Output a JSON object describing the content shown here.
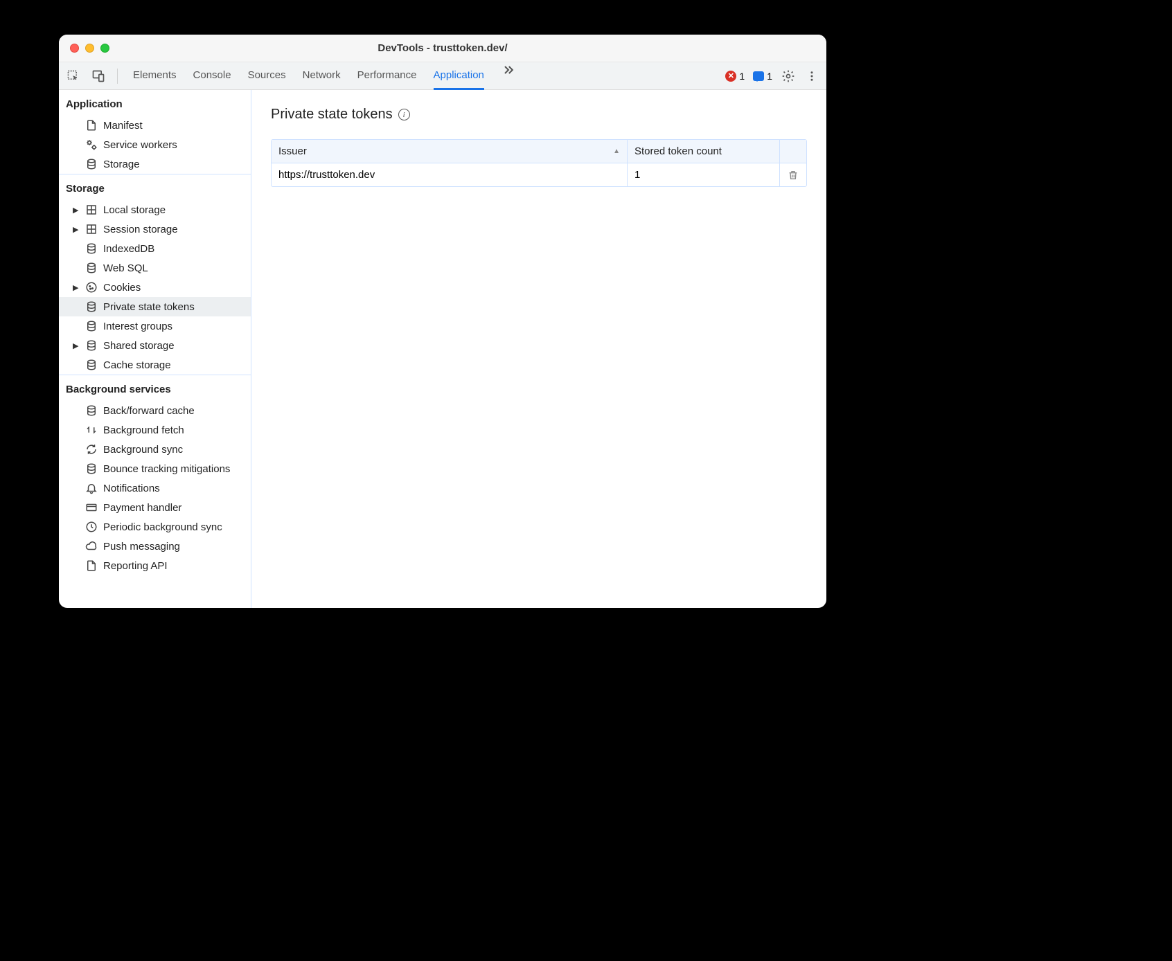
{
  "window": {
    "title": "DevTools - trusttoken.dev/"
  },
  "tabs": {
    "items": [
      "Elements",
      "Console",
      "Sources",
      "Network",
      "Performance",
      "Application"
    ],
    "active": "Application"
  },
  "badges": {
    "errors": "1",
    "messages": "1"
  },
  "sidebar": {
    "sections": [
      {
        "title": "Application",
        "items": [
          {
            "label": "Manifest",
            "icon": "file",
            "arrow": false
          },
          {
            "label": "Service workers",
            "icon": "gears",
            "arrow": false
          },
          {
            "label": "Storage",
            "icon": "db",
            "arrow": false
          }
        ]
      },
      {
        "title": "Storage",
        "items": [
          {
            "label": "Local storage",
            "icon": "grid",
            "arrow": true
          },
          {
            "label": "Session storage",
            "icon": "grid",
            "arrow": true
          },
          {
            "label": "IndexedDB",
            "icon": "db",
            "arrow": false
          },
          {
            "label": "Web SQL",
            "icon": "db",
            "arrow": false
          },
          {
            "label": "Cookies",
            "icon": "cookie",
            "arrow": true
          },
          {
            "label": "Private state tokens",
            "icon": "db",
            "arrow": false,
            "selected": true
          },
          {
            "label": "Interest groups",
            "icon": "db",
            "arrow": false
          },
          {
            "label": "Shared storage",
            "icon": "db",
            "arrow": true
          },
          {
            "label": "Cache storage",
            "icon": "db",
            "arrow": false
          }
        ]
      },
      {
        "title": "Background services",
        "items": [
          {
            "label": "Back/forward cache",
            "icon": "db",
            "arrow": false
          },
          {
            "label": "Background fetch",
            "icon": "swap",
            "arrow": false
          },
          {
            "label": "Background sync",
            "icon": "sync",
            "arrow": false
          },
          {
            "label": "Bounce tracking mitigations",
            "icon": "db",
            "arrow": false
          },
          {
            "label": "Notifications",
            "icon": "bell",
            "arrow": false
          },
          {
            "label": "Payment handler",
            "icon": "card",
            "arrow": false
          },
          {
            "label": "Periodic background sync",
            "icon": "clock",
            "arrow": false
          },
          {
            "label": "Push messaging",
            "icon": "cloud",
            "arrow": false
          },
          {
            "label": "Reporting API",
            "icon": "file",
            "arrow": false
          }
        ]
      }
    ]
  },
  "main": {
    "title": "Private state tokens",
    "table": {
      "headers": {
        "issuer": "Issuer",
        "count": "Stored token count"
      },
      "rows": [
        {
          "issuer": "https://trusttoken.dev",
          "count": "1"
        }
      ]
    }
  }
}
